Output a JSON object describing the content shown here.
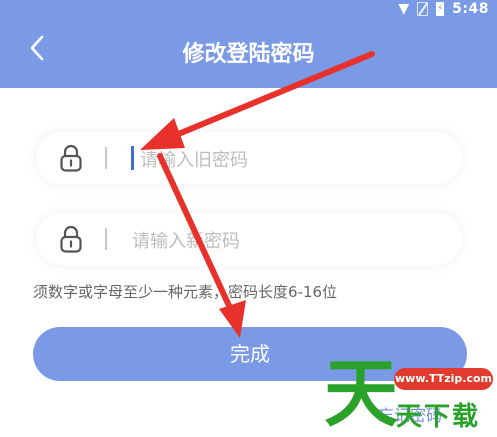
{
  "status_bar": {
    "time": "5:48",
    "battery_glyph": "⚡"
  },
  "header": {
    "title": "修改登陆密码",
    "back_icon": "chevron-left-icon"
  },
  "form": {
    "old_password": {
      "placeholder": "请输入旧密码",
      "icon": "lock-icon"
    },
    "new_password": {
      "placeholder": "请输入新密码",
      "icon": "lock-icon"
    },
    "hint": "须数字或字母至少一种元素，密码长度6-16位",
    "submit_label": "完成",
    "forgot_label": "忘记密码"
  },
  "watermark": {
    "glyph": "天",
    "url": "www.TTzip.com",
    "text": "天下载"
  },
  "colors": {
    "accent": "#7b9ae6",
    "arrow": "#e8312a",
    "watermark_green": "#2aa22a"
  }
}
